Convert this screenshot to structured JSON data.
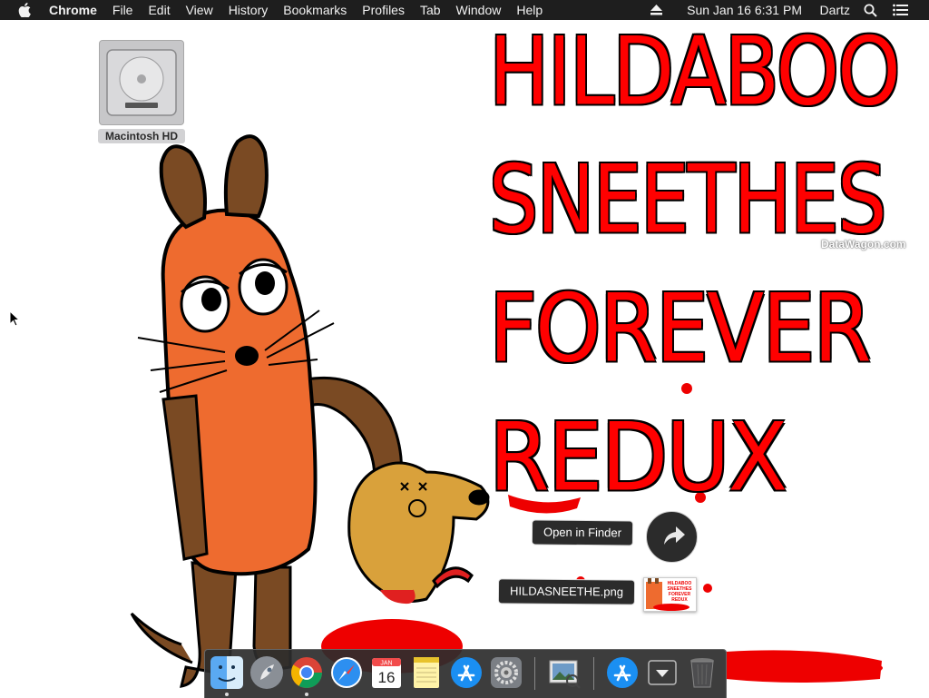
{
  "menubar": {
    "app_name": "Chrome",
    "menus": [
      "File",
      "Edit",
      "View",
      "History",
      "Bookmarks",
      "Profiles",
      "Tab",
      "Window",
      "Help"
    ],
    "datetime": "Sun Jan 16  6:31 PM",
    "user": "Dartz",
    "icons": [
      "apple-icon",
      "eject-icon",
      "spotlight-search-icon",
      "notification-center-icon"
    ]
  },
  "desktop": {
    "drive_label": "Macintosh HD",
    "wallpaper_lines": [
      "HILDABOO",
      "SNEETHES",
      "FOREVER",
      "REDUX"
    ],
    "watermark": "DataWagon.com"
  },
  "drag_preview": {
    "open_label": "Open in Finder",
    "filename": "HILDASNEETHE.png",
    "thumbnail_text": "HILDABOO SNEETHES FOREVER REDUX",
    "share_icon": "share-arrow-icon"
  },
  "dock": {
    "calendar_month": "JAN",
    "calendar_day": "16",
    "apps": [
      "finder-icon",
      "launchpad-icon",
      "chrome-icon",
      "safari-icon",
      "calendar-icon",
      "notes-icon",
      "app-store-icon",
      "system-preferences-icon",
      "preview-icon",
      "applications-folder-icon",
      "downloads-stack-icon",
      "trash-icon"
    ]
  },
  "colors": {
    "menubar_bg": "#1e1e1e",
    "title_red": "#ff0000",
    "mouse_orange": "#ee6b2f",
    "mouse_brown": "#7a4a23",
    "dog_tan": "#d9a13b"
  }
}
